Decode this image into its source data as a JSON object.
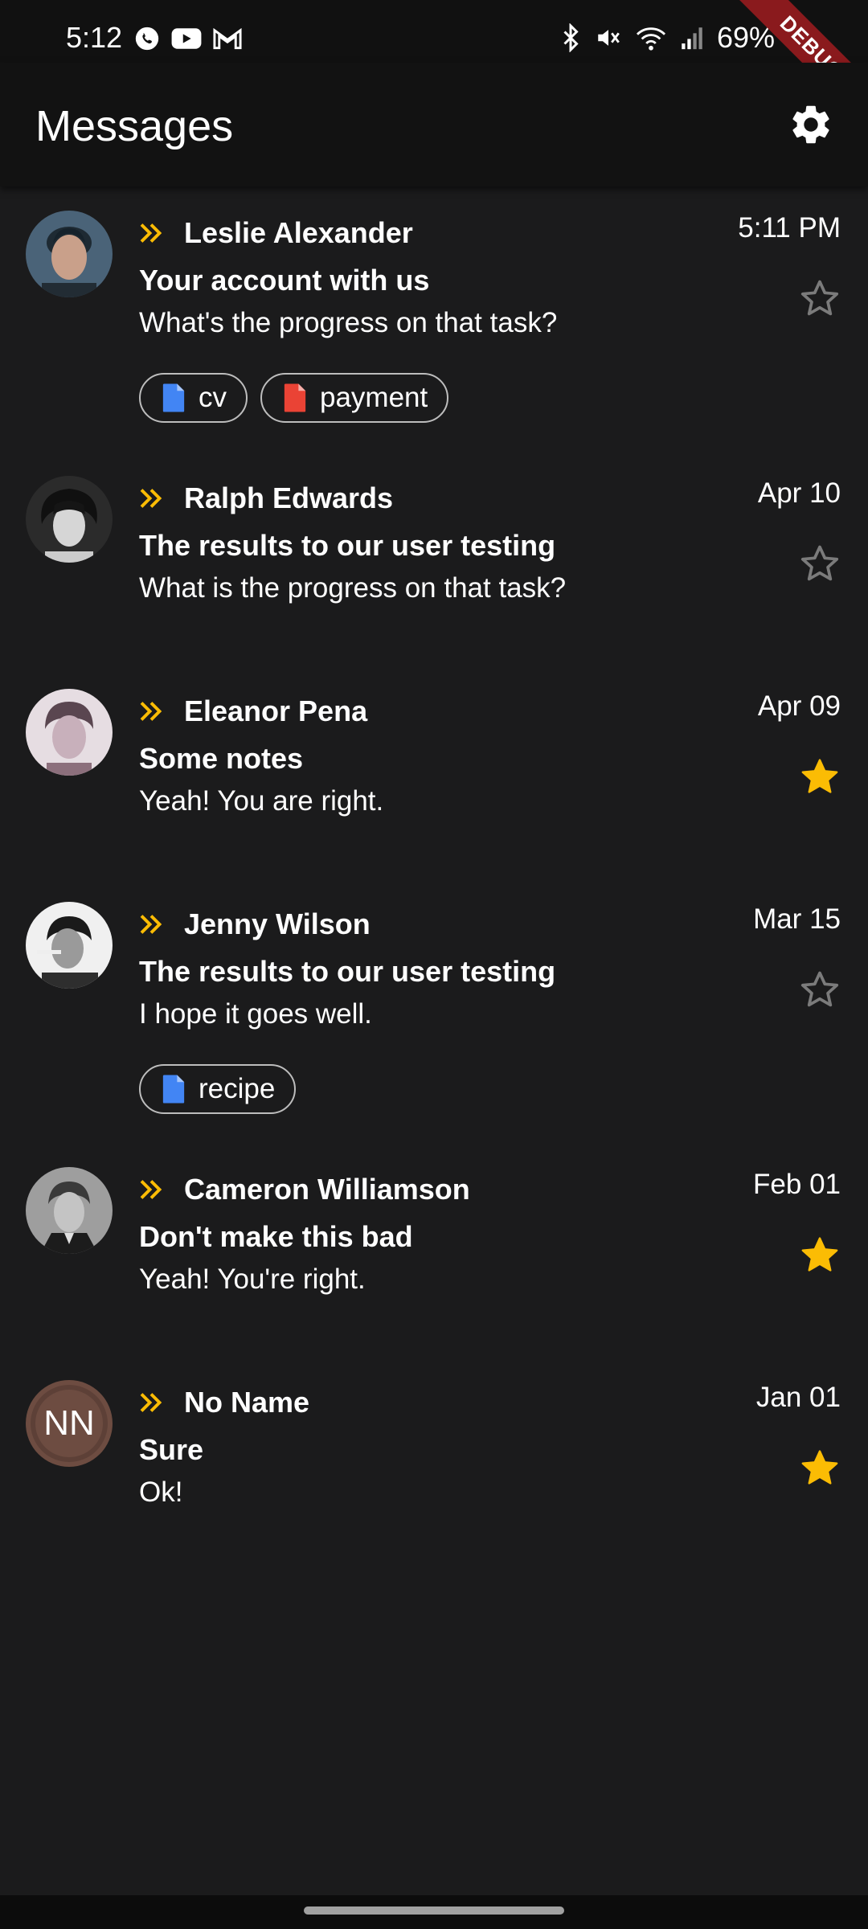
{
  "status_bar": {
    "time": "5:12",
    "battery": "69%",
    "left_icons": [
      "whatsapp-icon",
      "youtube-icon",
      "gmail-icon"
    ],
    "right_icons": [
      "bluetooth-icon",
      "mute-icon",
      "wifi-icon",
      "signal-icon",
      "battery-icon"
    ]
  },
  "debug_banner": "DEBUG",
  "app_bar": {
    "title": "Messages",
    "settings_icon": "gear-icon"
  },
  "colors": {
    "background": "#1b1b1c",
    "app_bar": "#121212",
    "accent_star": "#fbbc04",
    "forward_icon": "#fbbc04",
    "doc_blue": "#4285f4",
    "doc_red": "#ea4335",
    "avatar_initials_bg": "#6d4c41"
  },
  "messages": [
    {
      "sender": "Leslie Alexander",
      "date": "5:11 PM",
      "subject": "Your account with us",
      "preview": "What's the progress on that task?",
      "starred": false,
      "avatar": "photo",
      "attachments": [
        {
          "label": "cv",
          "color": "blue"
        },
        {
          "label": "payment",
          "color": "red"
        }
      ]
    },
    {
      "sender": "Ralph Edwards",
      "date": "Apr 10",
      "subject": "The results to our user testing",
      "preview": "What is the progress on that task?",
      "starred": false,
      "avatar": "photo",
      "attachments": []
    },
    {
      "sender": "Eleanor Pena",
      "date": "Apr 09",
      "subject": "Some notes",
      "preview": "Yeah! You are right.",
      "starred": true,
      "avatar": "photo",
      "attachments": []
    },
    {
      "sender": "Jenny Wilson",
      "date": "Mar 15",
      "subject": "The results to our user testing",
      "preview": "I hope it goes well.",
      "starred": false,
      "avatar": "photo",
      "attachments": [
        {
          "label": "recipe",
          "color": "blue"
        }
      ]
    },
    {
      "sender": "Cameron Williamson",
      "date": "Feb 01",
      "subject": "Don't make this bad",
      "preview": "Yeah! You're right.",
      "starred": true,
      "avatar": "photo",
      "attachments": []
    },
    {
      "sender": "No Name",
      "date": "Jan 01",
      "subject": "Sure",
      "preview": "Ok!",
      "starred": true,
      "avatar": "initials",
      "initials": "NN",
      "attachments": []
    }
  ]
}
